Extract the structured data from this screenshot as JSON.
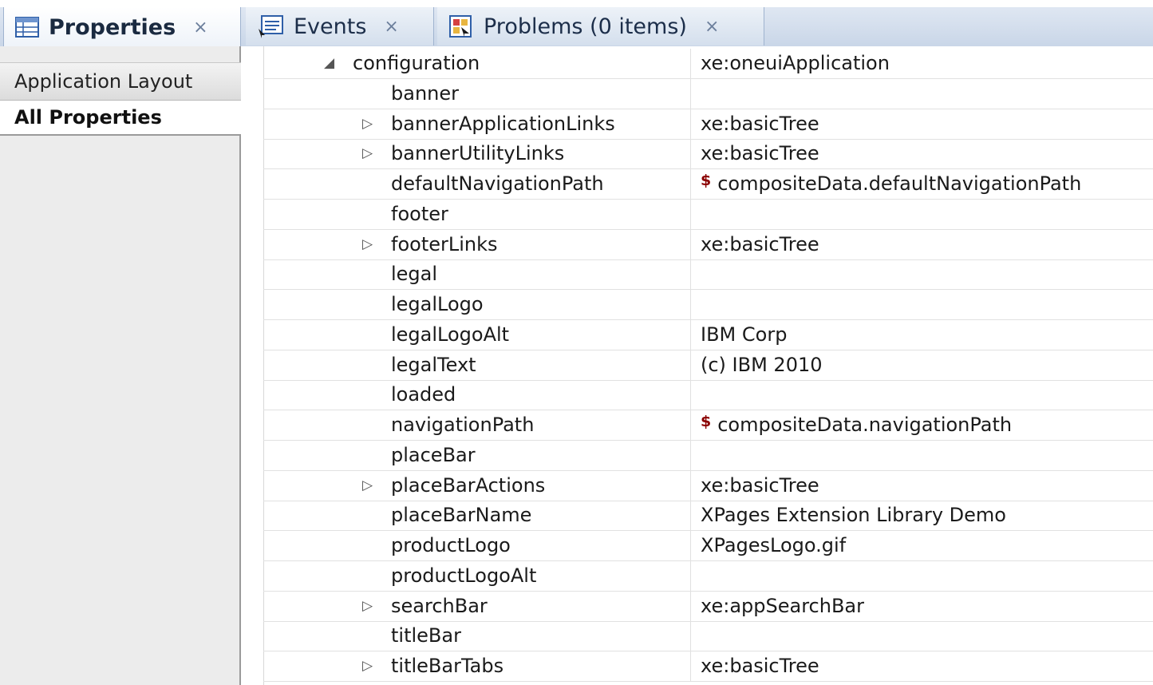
{
  "tabs": [
    {
      "label": "Properties",
      "close": "×",
      "icon": "properties-table-icon"
    },
    {
      "label": "Events",
      "close": "×",
      "icon": "events-icon"
    },
    {
      "label": "Problems (0 items)",
      "close": "×",
      "icon": "problems-icon"
    }
  ],
  "sidebar": {
    "items": [
      {
        "label": "Application Layout"
      },
      {
        "label": "All Properties"
      }
    ]
  },
  "properties": {
    "rows": [
      {
        "name": "configuration",
        "value": "xe:oneuiApplication",
        "twisty": "◢",
        "computed": false
      },
      {
        "name": "banner",
        "value": "",
        "twisty": "",
        "computed": false
      },
      {
        "name": "bannerApplicationLinks",
        "value": "xe:basicTree",
        "twisty": "▷",
        "computed": false
      },
      {
        "name": "bannerUtilityLinks",
        "value": "xe:basicTree",
        "twisty": "▷",
        "computed": false
      },
      {
        "name": "defaultNavigationPath",
        "value": "compositeData.defaultNavigationPath",
        "twisty": "",
        "computed": true
      },
      {
        "name": "footer",
        "value": "",
        "twisty": "",
        "computed": false
      },
      {
        "name": "footerLinks",
        "value": "xe:basicTree",
        "twisty": "▷",
        "computed": false
      },
      {
        "name": "legal",
        "value": "",
        "twisty": "",
        "computed": false
      },
      {
        "name": "legalLogo",
        "value": "",
        "twisty": "",
        "computed": false
      },
      {
        "name": "legalLogoAlt",
        "value": "IBM Corp",
        "twisty": "",
        "computed": false
      },
      {
        "name": "legalText",
        "value": "(c) IBM 2010",
        "twisty": "",
        "computed": false
      },
      {
        "name": "loaded",
        "value": "",
        "twisty": "",
        "computed": false
      },
      {
        "name": "navigationPath",
        "value": "compositeData.navigationPath",
        "twisty": "",
        "computed": true
      },
      {
        "name": "placeBar",
        "value": "",
        "twisty": "",
        "computed": false
      },
      {
        "name": "placeBarActions",
        "value": "xe:basicTree",
        "twisty": "▷",
        "computed": false
      },
      {
        "name": "placeBarName",
        "value": "XPages Extension Library Demo",
        "twisty": "",
        "computed": false
      },
      {
        "name": "productLogo",
        "value": "XPagesLogo.gif",
        "twisty": "",
        "computed": false
      },
      {
        "name": "productLogoAlt",
        "value": "",
        "twisty": "",
        "computed": false
      },
      {
        "name": "searchBar",
        "value": "xe:appSearchBar",
        "twisty": "▷",
        "computed": false
      },
      {
        "name": "titleBar",
        "value": "",
        "twisty": "",
        "computed": false
      },
      {
        "name": "titleBarTabs",
        "value": "xe:basicTree",
        "twisty": "▷",
        "computed": false
      }
    ],
    "computed_marker": "$"
  },
  "colors": {
    "accent": "#1c2e4a",
    "tab_border": "#9fb3cf",
    "computed_marker": "#8b0000"
  }
}
